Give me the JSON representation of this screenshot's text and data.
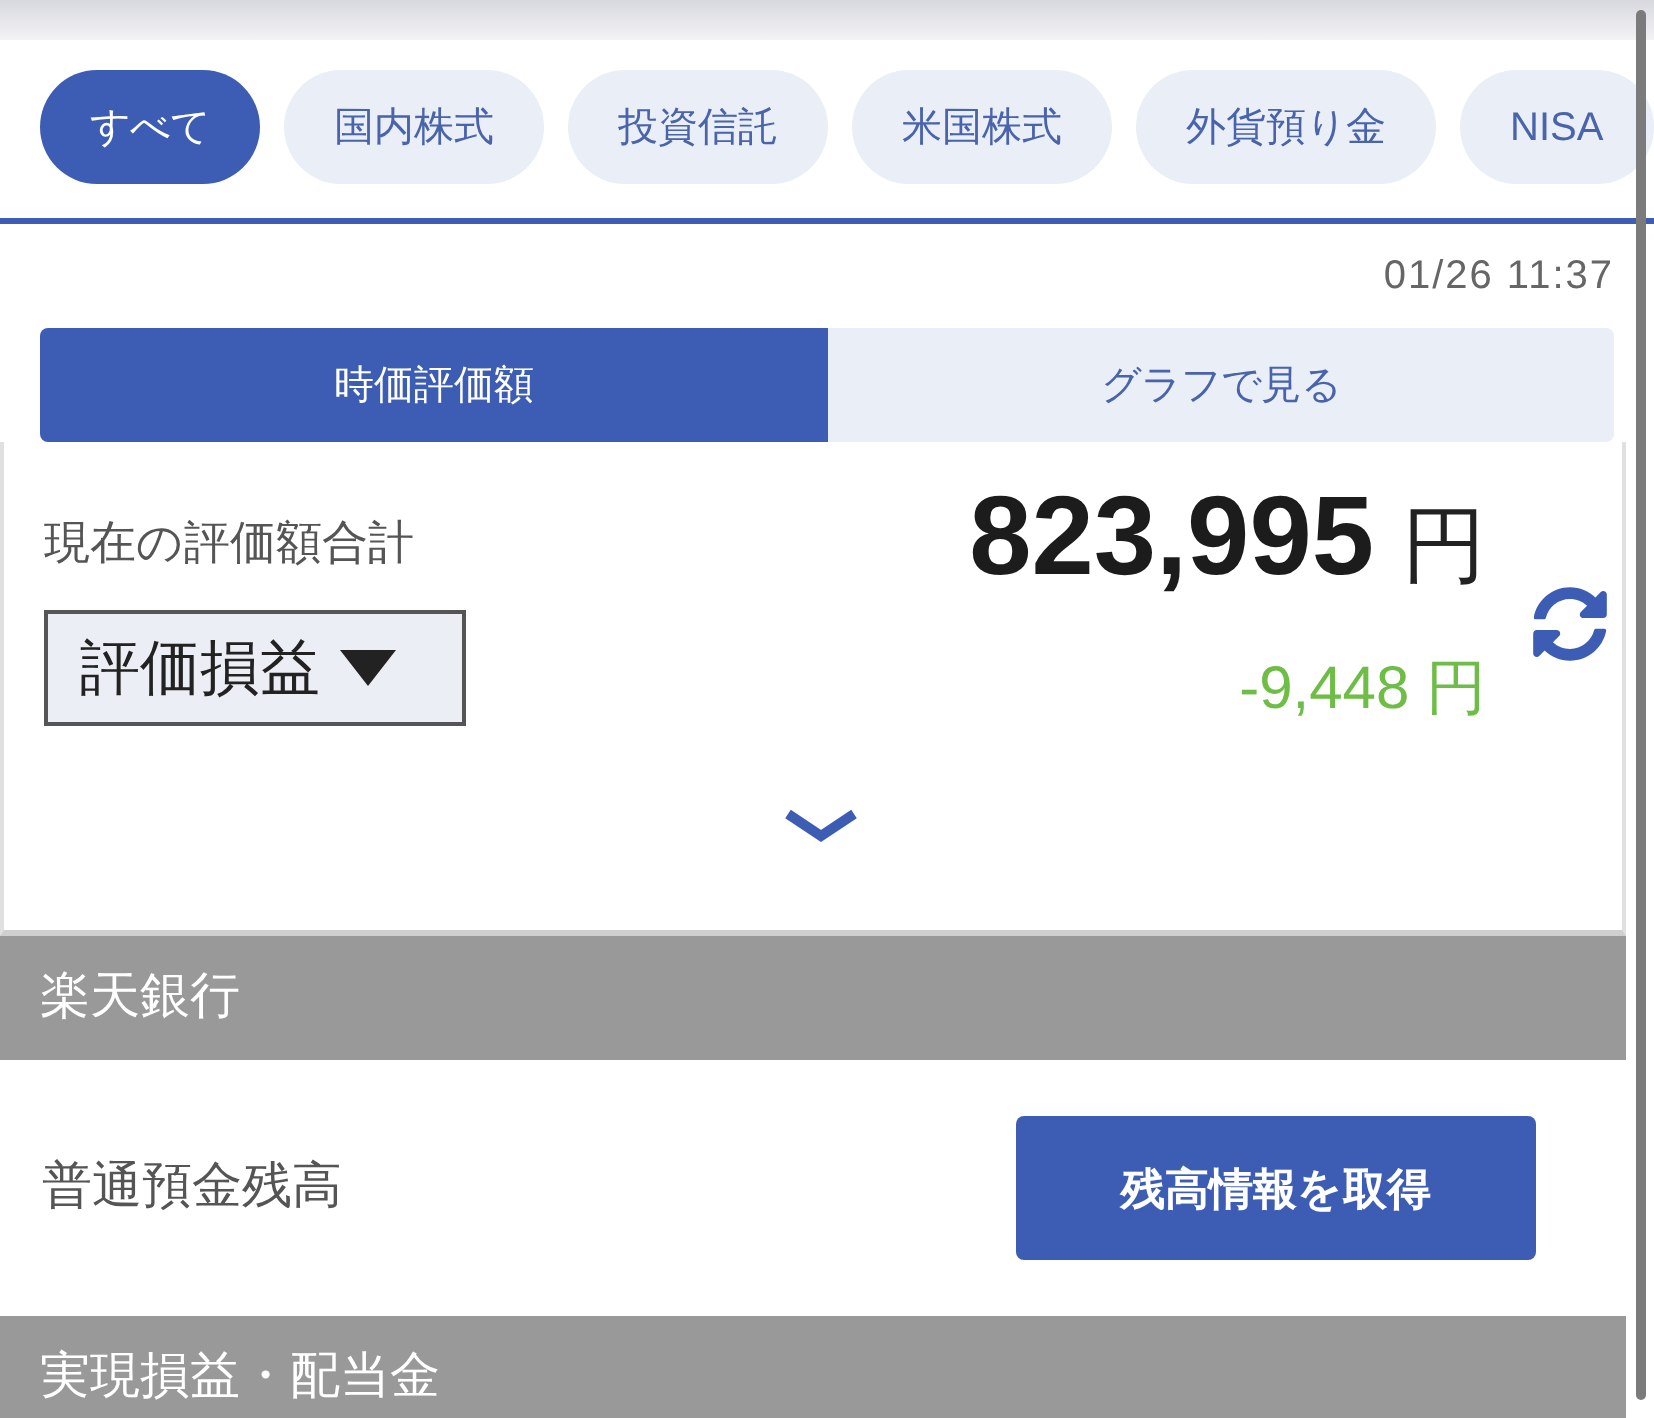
{
  "filter_chips": [
    {
      "label": "すべて",
      "selected": true
    },
    {
      "label": "国内株式",
      "selected": false
    },
    {
      "label": "投資信託",
      "selected": false
    },
    {
      "label": "米国株式",
      "selected": false
    },
    {
      "label": "外貨預り金",
      "selected": false
    },
    {
      "label": "NISA",
      "selected": false
    }
  ],
  "timestamp": "01/26 11:37",
  "view_tabs": [
    {
      "label": "時価評価額",
      "selected": true
    },
    {
      "label": "グラフで見る",
      "selected": false
    }
  ],
  "valuation": {
    "label": "現在の評価額合計",
    "total": "823,995",
    "total_unit": "円",
    "mode_select": {
      "value": "評価損益"
    },
    "change": {
      "value": "-9,448",
      "unit": "円",
      "negative": true
    }
  },
  "sections": [
    {
      "title": "楽天銀行",
      "rows": [
        {
          "label": "普通預金残高",
          "button": "残高情報を取得"
        }
      ]
    },
    {
      "title": "実現損益・配当金"
    }
  ]
}
